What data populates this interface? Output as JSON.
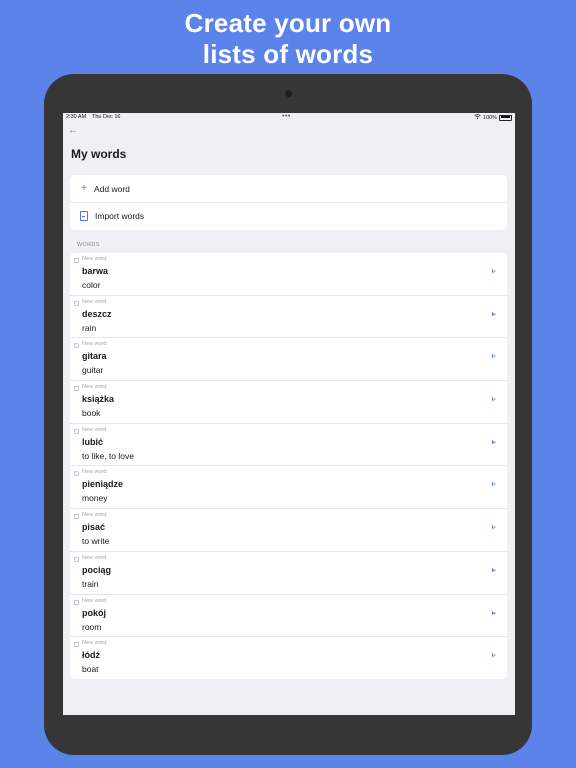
{
  "headline": {
    "line1": "Create your own",
    "line2": "lists of words"
  },
  "status_bar": {
    "time": "2:30 AM",
    "date": "Thu Dec 16",
    "dots": "•••",
    "battery": "100%"
  },
  "nav": {
    "back_glyph": "←",
    "title": "My words"
  },
  "actions": {
    "add_icon": "+",
    "add_label": "Add word",
    "import_label": "Import words"
  },
  "section": {
    "words_header": "WORDS"
  },
  "words": [
    {
      "status": "New word",
      "word": "barwa",
      "translation": "color"
    },
    {
      "status": "New word",
      "word": "deszcz",
      "translation": "rain"
    },
    {
      "status": "New word",
      "word": "gitara",
      "translation": "guitar"
    },
    {
      "status": "New word",
      "word": "książka",
      "translation": "book"
    },
    {
      "status": "New word",
      "word": "lubić",
      "translation": "to like, to love"
    },
    {
      "status": "New word",
      "word": "pieniądze",
      "translation": "money"
    },
    {
      "status": "New word",
      "word": "pisać",
      "translation": "to write"
    },
    {
      "status": "New word",
      "word": "pociąg",
      "translation": "train"
    },
    {
      "status": "New word",
      "word": "pokój",
      "translation": "room"
    },
    {
      "status": "New word",
      "word": "łódź",
      "translation": "boat"
    }
  ],
  "icons": {
    "back": "arrow-left-icon",
    "add": "plus-icon",
    "import": "document-icon",
    "play": "play-icon",
    "wifi": "wifi-icon",
    "battery": "battery-icon"
  },
  "colors": {
    "background": "#5b83ea",
    "accent": "#4a7ae8",
    "tablet_frame": "#363636",
    "screen_bg": "#f0f0f4"
  }
}
